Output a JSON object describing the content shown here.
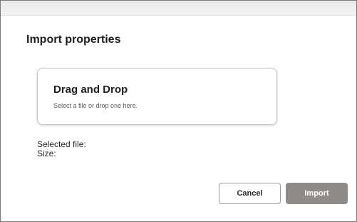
{
  "dialog": {
    "title": "Import properties"
  },
  "dropzone": {
    "title": "Drag and Drop",
    "hint": "Select a file or drop one here."
  },
  "file_info": {
    "selected_label": "Selected file:",
    "size_label": "Size:"
  },
  "actions": {
    "cancel_label": "Cancel",
    "import_label": "Import"
  }
}
